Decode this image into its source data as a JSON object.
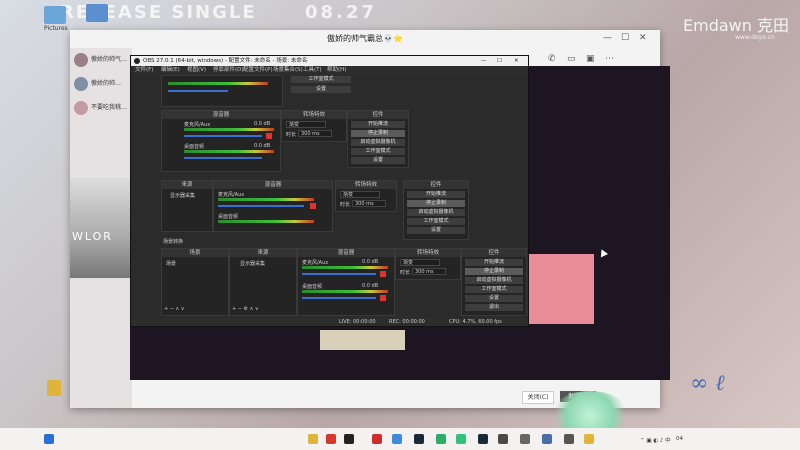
{
  "desktop": {
    "banner": "RELEASE SINGLE",
    "date": "08.27",
    "watermark": "Emdawn 克田",
    "watermark_sub": "www.doyo.cn",
    "icons": [
      {
        "label": "Pictures",
        "icon": "image-folder-icon",
        "color": "#6aa6d8"
      },
      {
        "label": "",
        "icon": "monitor-icon",
        "color": "#5b8fd0"
      },
      {
        "label": "",
        "icon": "folder-icon",
        "color": "#e0b43a"
      }
    ]
  },
  "chat": {
    "title": "傲娇的帅气霸总💀⭐",
    "close_button": "关闭(C)",
    "send_button": "发送(S)",
    "side_text": "WLOR",
    "contacts": [
      {
        "name": "傲娇的帅气…"
      },
      {
        "name": "傲娇的帅…"
      },
      {
        "name": "不要吃我桃…"
      }
    ]
  },
  "obs": {
    "title": "OBS 27.0.1 (64-bit, windows) - 配置文件: 未命名 - 场景: 未命名",
    "menu": [
      "文件(F)",
      "编辑(E)",
      "视图(V)",
      "停靠部件(D)",
      "配置文件(P)",
      "场景集合(S)",
      "工具(T)",
      "帮助(H)"
    ],
    "panels": {
      "mixer": "混音器",
      "transitions": "转场特效",
      "controls": "控件",
      "sources": "来源",
      "scenes": "场景",
      "scene_transitions": "场景转换"
    },
    "controls": [
      "开始推流",
      "停止录制",
      "启动虚拟摄像机",
      "工作室模式",
      "设置",
      "退出"
    ],
    "mixer_tracks": [
      {
        "name": "麦克风/Aux",
        "db": "0.0 dB"
      },
      {
        "name": "桌面音频",
        "db": "0.0 dB"
      }
    ],
    "fade": "渐变",
    "duration_label": "时长",
    "duration_value": "300 ms",
    "source_item": "显示器采集",
    "scene_item": "场景",
    "status": {
      "live": "LIVE: 00:00:00",
      "rec": "REC: 00:00:00",
      "cpu": "CPU: 4.7%, 60.00 fps"
    }
  },
  "taskbar": {
    "time": "04",
    "icons": [
      "windows-logo-icon",
      "file-explorer-icon",
      "red-app-icon",
      "qq-icon",
      "netease-music-icon",
      "chrome-icon",
      "steam-icon",
      "wechat-icon",
      "qq-music-icon",
      "steam-icon",
      "game-icon",
      "record-icon",
      "folder-icon"
    ]
  }
}
